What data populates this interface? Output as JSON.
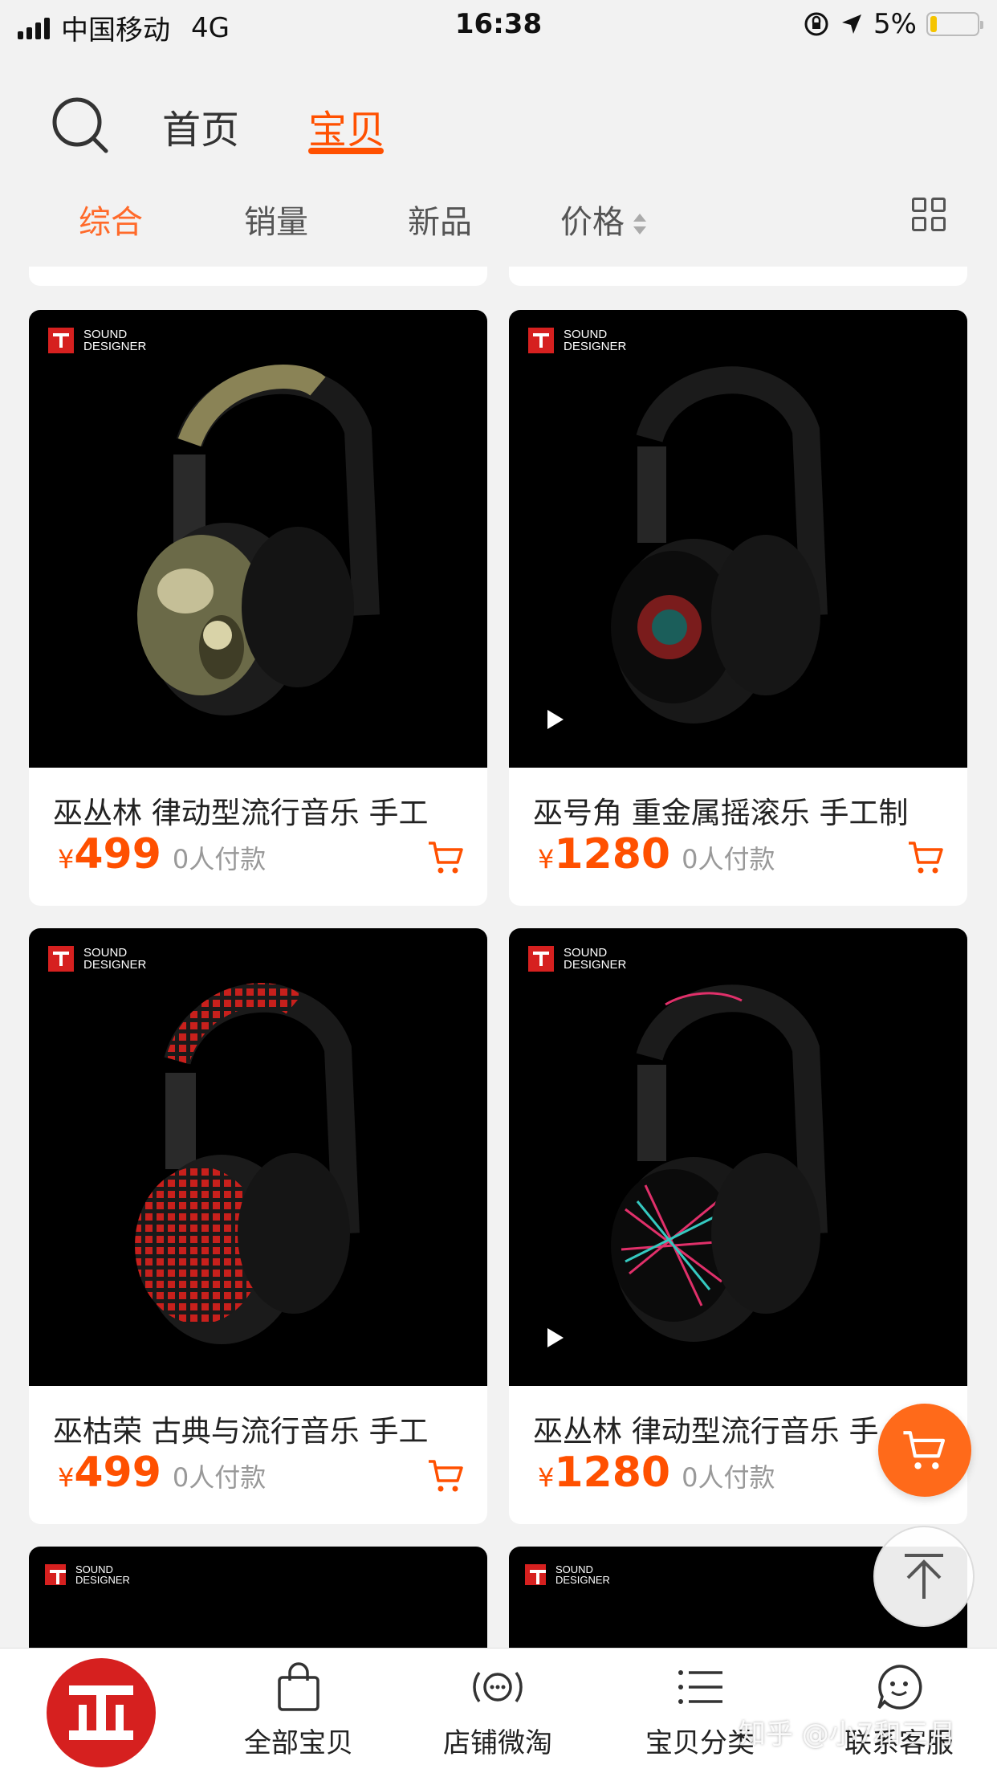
{
  "status_bar": {
    "carrier": "中国移动",
    "network": "4G",
    "time": "16:38",
    "battery": "5%"
  },
  "top_nav": {
    "home": "首页",
    "items": "宝贝"
  },
  "sort_bar": {
    "comprehensive": "综合",
    "sales": "销量",
    "new": "新品",
    "price": "价格"
  },
  "brand": {
    "line1": "SOUND",
    "line2": "DESIGNER"
  },
  "products": [
    {
      "title": "巫丛林 律动型流行音乐 手工",
      "currency": "¥",
      "price": "499",
      "paid": "0人付款"
    },
    {
      "title": "巫号角 重金属摇滚乐 手工制",
      "currency": "¥",
      "price": "1280",
      "paid": "0人付款"
    },
    {
      "title": "巫枯荣 古典与流行音乐 手工",
      "currency": "¥",
      "price": "499",
      "paid": "0人付款"
    },
    {
      "title": "巫丛林 律动型流行音乐 手",
      "currency": "¥",
      "price": "1280",
      "paid": "0人付款"
    }
  ],
  "tab_bar": {
    "all": "全部宝贝",
    "weitao": "店铺微淘",
    "category": "宝贝分类",
    "service": "联系客服"
  },
  "watermark": "知乎 @小7和三月",
  "colors": {
    "accent": "#ff5000",
    "brand_red": "#d6201f"
  }
}
